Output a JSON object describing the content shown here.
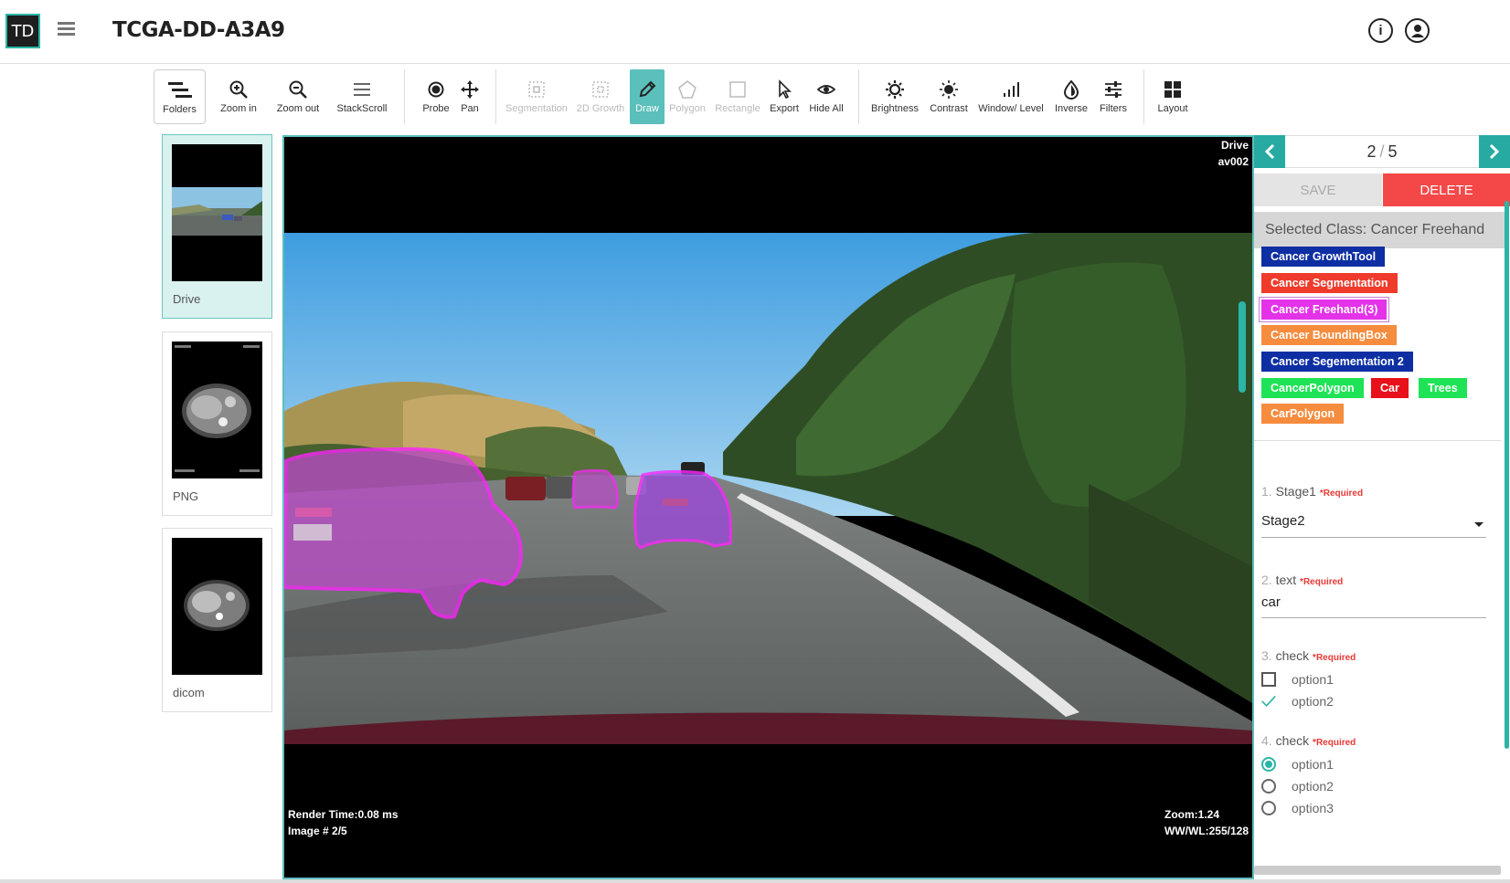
{
  "header": {
    "logo": "TD",
    "title": "TCGA-DD-A3A9",
    "info_icon": "info-icon",
    "user_icon": "user-icon"
  },
  "toolbar": {
    "folders": "Folders",
    "zoom_in": "Zoom in",
    "zoom_out": "Zoom out",
    "stackscroll": "StackScroll",
    "probe": "Probe",
    "pan": "Pan",
    "segmentation": "Segmentation",
    "growth": "2D Growth",
    "draw": "Draw",
    "polygon": "Polygon",
    "rectangle": "Rectangle",
    "export": "Export",
    "hide_all": "Hide All",
    "brightness": "Brightness",
    "contrast": "Contrast",
    "window_level": "Window/ Level",
    "inverse": "Inverse",
    "filters": "Filters",
    "layout": "Layout"
  },
  "thumbnails": [
    {
      "label": "Drive"
    },
    {
      "label": "PNG"
    },
    {
      "label": "dicom"
    }
  ],
  "viewport": {
    "top_right_1": "Drive",
    "top_right_2": "av002",
    "render_time": "Render Time:0.08 ms",
    "image_index": "Image # 2/5",
    "zoom": "Zoom:1.24",
    "wwwl": "WW/WL:255/128"
  },
  "panel": {
    "counter_current": "2",
    "counter_sep": "/",
    "counter_total": "5",
    "save": "SAVE",
    "delete": "DELETE",
    "selected_class": "Selected Class: Cancer Freehand",
    "chips": [
      {
        "label": "Cancer GrowthTool",
        "color": "#0d2fa3"
      },
      {
        "label": "Cancer Segmentation",
        "color": "#ef3b2c"
      },
      {
        "label": "Cancer Freehand(3)",
        "color": "#e432e8"
      },
      {
        "label": "Cancer BoundingBox",
        "color": "#f58c3e"
      },
      {
        "label": "Cancer Segementation 2",
        "color": "#0d2fa3"
      },
      {
        "label": "CancerPolygon",
        "color": "#1fe356"
      },
      {
        "label": "Car",
        "color": "#e8101a"
      },
      {
        "label": "Trees",
        "color": "#1fe356"
      },
      {
        "label": "CarPolygon",
        "color": "#f58c3e"
      }
    ],
    "q1": {
      "num": "1.",
      "label": "Stage1",
      "req": "*Required",
      "value": "Stage2"
    },
    "q2": {
      "num": "2.",
      "label": "text",
      "req": "*Required",
      "value": "car"
    },
    "q3": {
      "num": "3.",
      "label": "check",
      "req": "*Required",
      "options": [
        "option1",
        "option2"
      ]
    },
    "q4": {
      "num": "4.",
      "label": "check",
      "req": "*Required",
      "options": [
        "option1",
        "option2",
        "option3"
      ]
    }
  },
  "colors": {
    "accent": "#2bb5a6",
    "delete": "#f44848",
    "annotation": "#e432e8"
  }
}
